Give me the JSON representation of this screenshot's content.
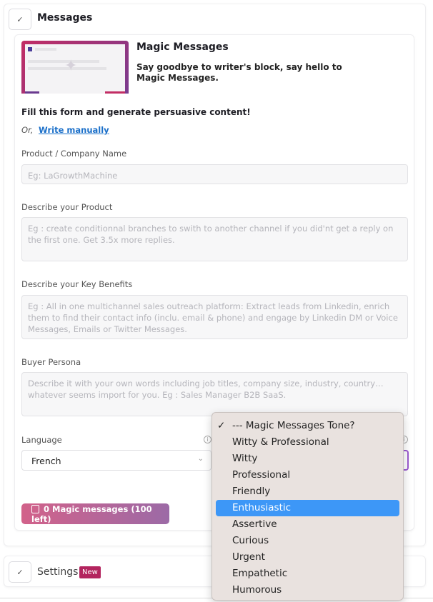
{
  "messages_section": {
    "title": "Messages",
    "check_icon": "checkmark-icon"
  },
  "intro": {
    "title": "Magic Messages",
    "description_line1": "Say goodbye to writer's block, say hello to",
    "description_line2": "Magic Messages."
  },
  "form": {
    "heading": "Fill this form and generate persuasive content!",
    "or_text": "Or,",
    "write_manually": "Write manually",
    "product_label": "Product / Company Name",
    "product_placeholder": "Eg: LaGrowthMachine",
    "describe_label": "Describe your Product",
    "describe_placeholder": "Eg : create conditionnal branches to swith to another channel if you did'nt get a reply on the first one. Get 3.5x more replies.",
    "benefits_label": "Describe your Key Benefits",
    "benefits_placeholder": "Eg : All in one multichannel sales outreach platform: Extract leads from Linkedin, enrich them to find their contact info (inclu. email & phone) and engage by Linkedin DM or Voice Messages, Emails or Twitter Messages.",
    "persona_label": "Buyer Persona",
    "persona_placeholder": "Describe it with your own words including job titles, company size, industry, country… whatever seems import for you. Eg : Sales Manager B2B SaaS.",
    "language_label": "Language",
    "language_value": "French",
    "generate_button": "0 Magic messages (100 left)"
  },
  "tone_dropdown": {
    "selected": "--- Magic Messages Tone?",
    "highlighted": "Enthusiastic",
    "options": [
      "--- Magic Messages Tone?",
      "Witty & Professional",
      "Witty",
      "Professional",
      "Friendly",
      "Enthusiastic",
      "Assertive",
      "Curious",
      "Urgent",
      "Empathetic",
      "Humorous"
    ]
  },
  "settings_section": {
    "title": "Settings",
    "badge": "New"
  },
  "colors": {
    "accent_purple": "#9b59d0",
    "button_gradient_start": "#d2628a",
    "button_gradient_end": "#9c6aa6",
    "highlight": "#3d97f7",
    "link": "#1a6fc9",
    "badge": "#b3245e"
  }
}
